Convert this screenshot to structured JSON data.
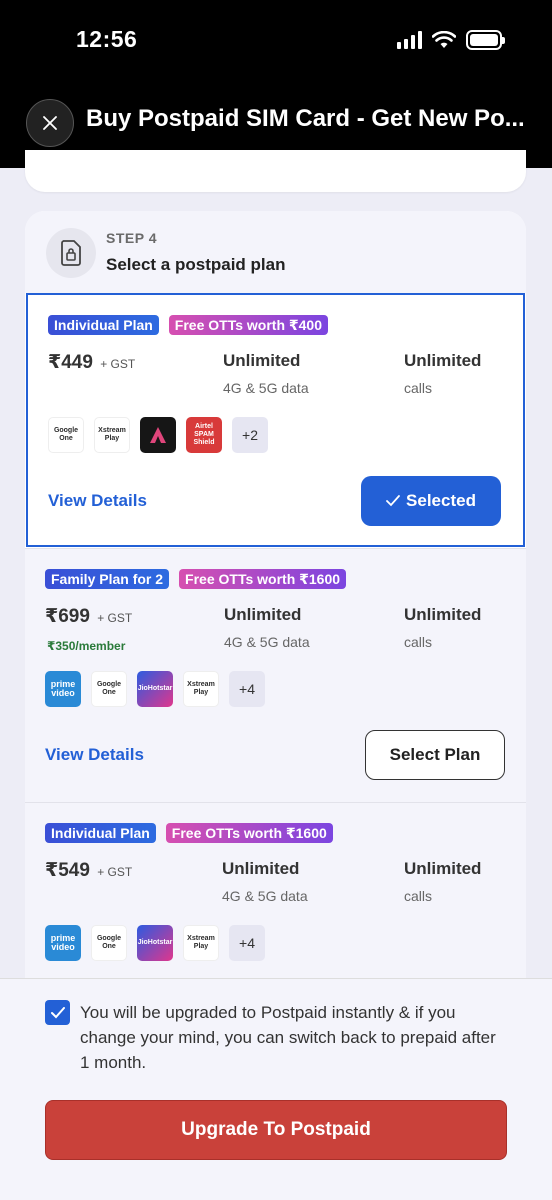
{
  "status_bar": {
    "time": "12:56"
  },
  "header": {
    "title": "Buy Postpaid SIM Card - Get New Po..."
  },
  "step": {
    "label": "STEP 4",
    "title": "Select a postpaid plan"
  },
  "plans": [
    {
      "badges": [
        "Individual Plan",
        "Free OTTs worth ₹400"
      ],
      "price": "₹449",
      "price_suffix": "+ GST",
      "data_value": "Unlimited",
      "data_label": "4G & 5G data",
      "calls_value": "Unlimited",
      "calls_label": "calls",
      "otts": [
        "Google One",
        "Xstream Play",
        "Adobe Express",
        "Airtel Spam Shield"
      ],
      "more": "+2",
      "view_details": "View Details",
      "action": "Selected",
      "selected": true
    },
    {
      "badges": [
        "Family Plan for 2",
        "Free OTTs worth ₹1600"
      ],
      "price": "₹699",
      "price_suffix": "+ GST",
      "per_member": "₹350/member",
      "data_value": "Unlimited",
      "data_label": "4G & 5G data",
      "calls_value": "Unlimited",
      "calls_label": "calls",
      "otts": [
        "Prime Video",
        "Google One",
        "JioHotstar",
        "Xstream Play"
      ],
      "more": "+4",
      "view_details": "View Details",
      "action": "Select Plan",
      "selected": false
    },
    {
      "badges": [
        "Individual Plan",
        "Free OTTs worth ₹1600"
      ],
      "price": "₹549",
      "price_suffix": "+ GST",
      "data_value": "Unlimited",
      "data_label": "4G & 5G data",
      "calls_value": "Unlimited",
      "calls_label": "calls",
      "otts": [
        "Prime Video",
        "Google One",
        "JioHotstar",
        "Xstream Play"
      ],
      "more": "+4",
      "selected": false
    }
  ],
  "ott_logo_text": {
    "google_one": "Google One",
    "xstream": "Xstream Play",
    "spam": "Airtel SPAM Shield",
    "prime": "prime video",
    "jio": "JioHotstar"
  },
  "consent": {
    "checked": true,
    "text": "You will be upgraded to Postpaid instantly & if you change your mind, you can switch back to prepaid after 1 month."
  },
  "cta": {
    "label": "Upgrade To Postpaid"
  },
  "colors": {
    "accent": "#2360d6",
    "cta": "#c9413a",
    "member_green": "#2a7a3a"
  }
}
